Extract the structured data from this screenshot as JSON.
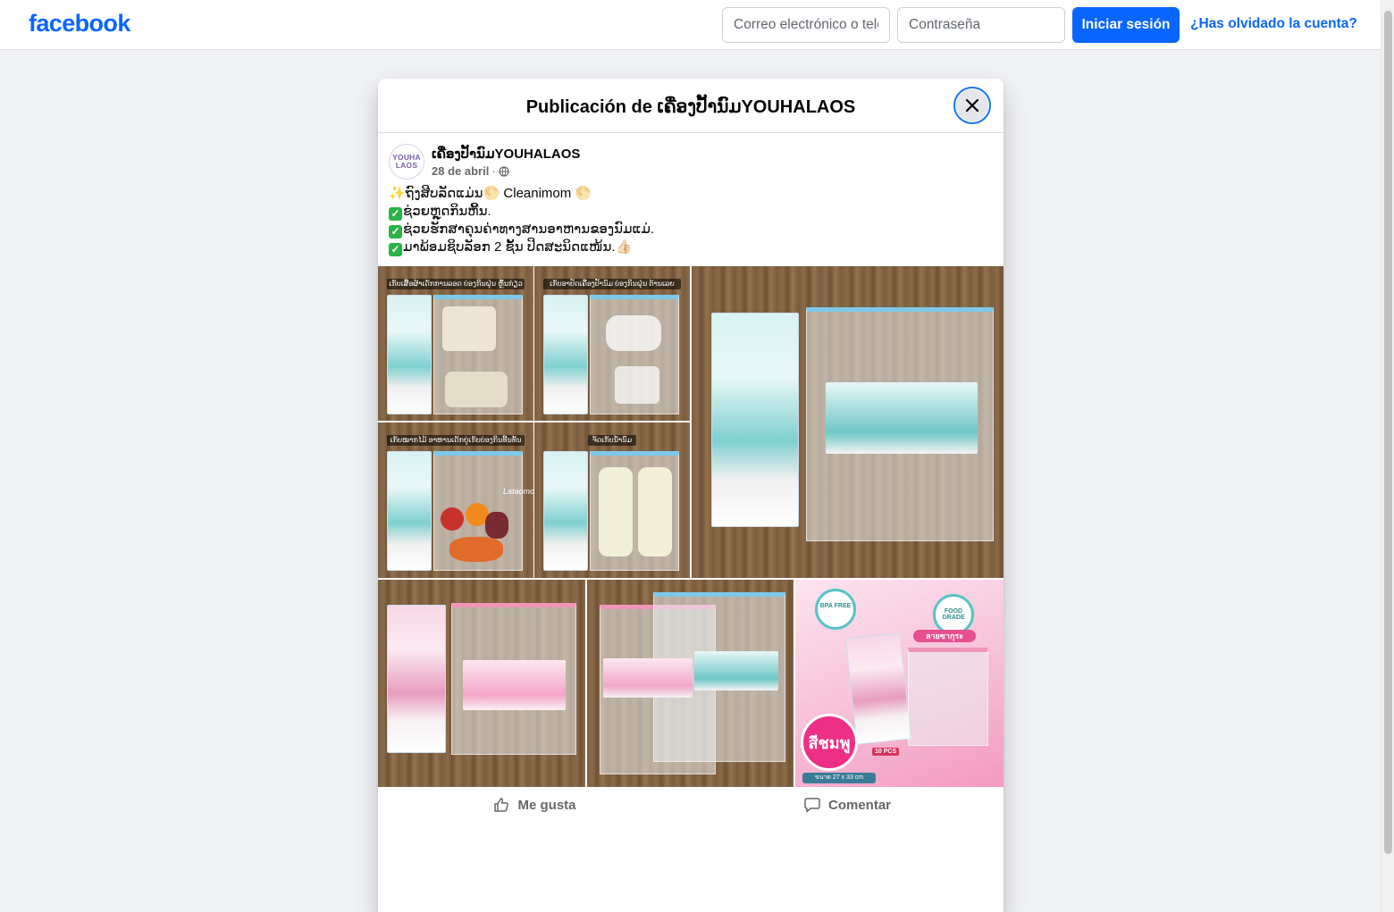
{
  "brand": {
    "logo_text": "facebook",
    "accent": "#0866ff"
  },
  "login": {
    "email_placeholder": "Correo electrónico o teléfono",
    "password_placeholder": "Contraseña",
    "submit_label": "Iniciar sesión",
    "forgot_label": "¿Has olvidado la cuenta?"
  },
  "modal": {
    "title": "Publicación de ເຄື່ອງປັ້ານົມYOUHALAOS",
    "close_icon": "close-icon"
  },
  "post": {
    "page_name": "ເຄື່ອງປັ້ານົມYOUHALAOS",
    "avatar_text": [
      "YOUHA",
      "LAOS"
    ],
    "date": "28 de abril",
    "separator": "·",
    "audience_icon": "globe-icon",
    "lines": [
      "✨ຖົງສີບລັດແມ່ນ🌕 Cleanimom 🌕",
      "ຊ່ວຍຫຼຸດກິນຫີ້ນ.",
      "ຊ່ວຍຮັກສາຄຸນຄ່າທາງສານອາຫານຂອງນົມແມ່.",
      "ມາພ້ອມຊິບລັອກ 2 ຊັ້ນ ປິດສະນິດແໜ້ນ.👍🏻"
    ],
    "photo_captions": [
      "ເກັບເສື້ອຜ້າເດັກການລອດ ບ່ອງກິນຝຸ່ນ ຫຼົ້ນກ່ຽວ",
      "ເກັບອາປັດເຄື່ອງປັ້ານົມ ບ່ອງກິນຝຸ່ນ ຕ້ານເລຍ",
      "ເກັບໝາກໄມ້ ອາຫານເດັກຍູ່ເກັບບ່ອງກິນທີ້ນທັ້ນ",
      "ຈັດເກັບນ້ຳນົມ"
    ],
    "watermark": "Lataomommie",
    "promo_badges": [
      "BPA FREE",
      "FOOD GRADE"
    ],
    "promo_title": "ลายซากุระ",
    "promo_circle": "สีชมพู",
    "promo_size": "ขนาด 27 x 33 cm",
    "promo_pcs": "10 PCS"
  },
  "actions": {
    "like_label": "Me gusta",
    "like_icon": "thumbs-up-icon",
    "comment_label": "Comentar",
    "comment_icon": "comment-icon"
  }
}
